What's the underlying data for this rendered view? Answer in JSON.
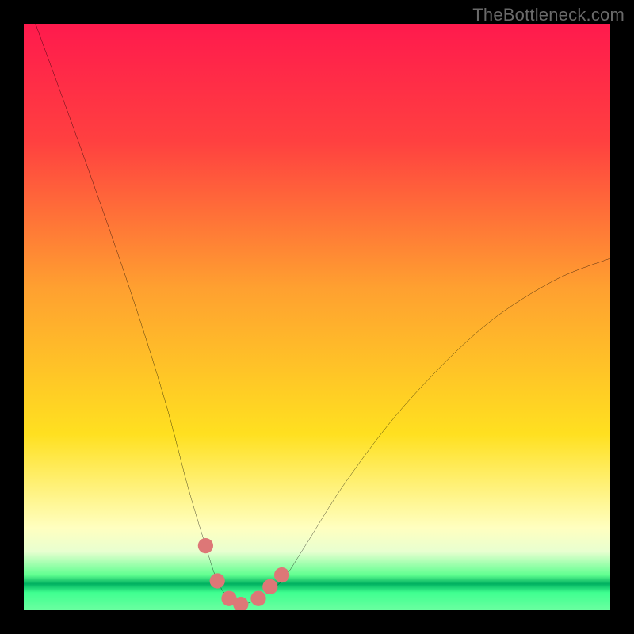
{
  "watermark": "TheBottleneck.com",
  "chart_data": {
    "type": "line",
    "title": "",
    "xlabel": "",
    "ylabel": "",
    "xlim": [
      0,
      100
    ],
    "ylim": [
      0,
      100
    ],
    "grid": false,
    "legend": false,
    "series": [
      {
        "name": "bottleneck-curve",
        "x": [
          2,
          10,
          18,
          24,
          28,
          31,
          33,
          35,
          37,
          40,
          44,
          48,
          55,
          65,
          78,
          90,
          100
        ],
        "values": [
          100,
          78,
          55,
          36,
          21,
          11,
          5,
          2,
          1,
          2,
          5,
          11,
          22,
          35,
          48,
          56,
          60
        ]
      }
    ],
    "markers": {
      "name": "highlight-dots",
      "color": "#d77",
      "x": [
        31,
        33,
        35,
        37,
        40,
        42,
        44
      ],
      "values": [
        11,
        5,
        2,
        1,
        2,
        4,
        6
      ]
    },
    "background_gradient": [
      {
        "stop": 0.0,
        "color": "#ff1a4d"
      },
      {
        "stop": 0.2,
        "color": "#ff4040"
      },
      {
        "stop": 0.45,
        "color": "#ffa030"
      },
      {
        "stop": 0.7,
        "color": "#ffe020"
      },
      {
        "stop": 0.86,
        "color": "#ffffc0"
      },
      {
        "stop": 0.9,
        "color": "#e8ffd0"
      },
      {
        "stop": 0.94,
        "color": "#60ff90"
      },
      {
        "stop": 0.955,
        "color": "#00b060"
      },
      {
        "stop": 0.97,
        "color": "#40ff90"
      },
      {
        "stop": 1.0,
        "color": "#6affa0"
      }
    ]
  }
}
